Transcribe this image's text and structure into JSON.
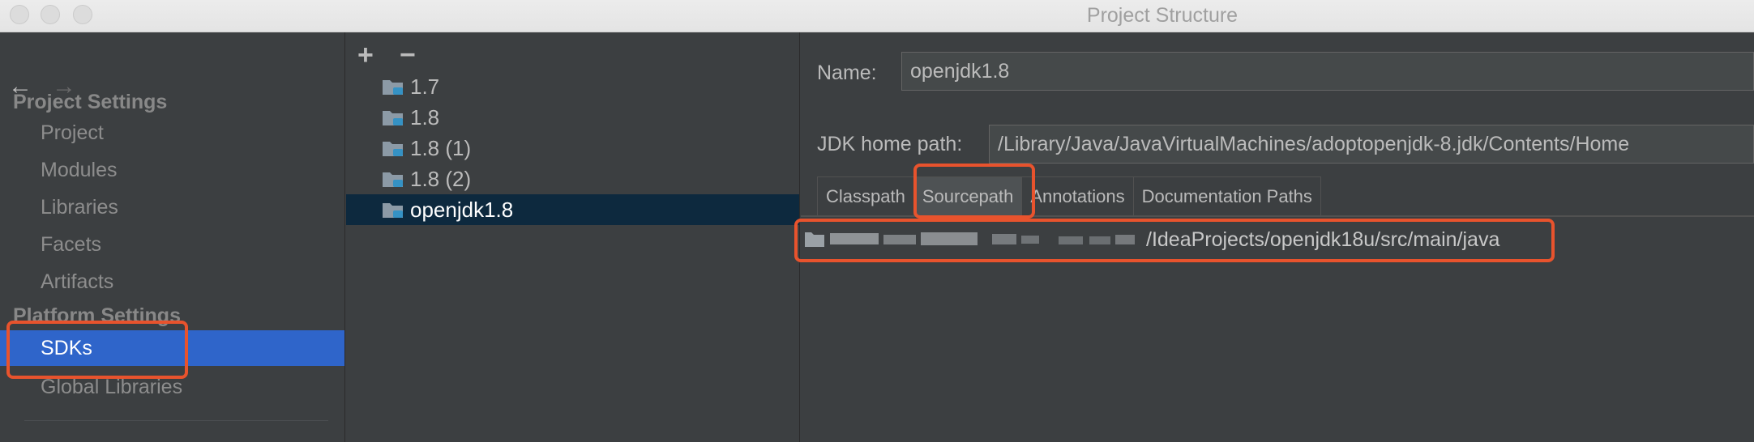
{
  "window": {
    "title": "Project Structure"
  },
  "nav": {
    "back_icon": "arrow-left-icon",
    "forward_icon": "arrow-right-icon"
  },
  "left_pane": {
    "project_settings_header": "Project Settings",
    "project_items": [
      {
        "label": "Project"
      },
      {
        "label": "Modules"
      },
      {
        "label": "Libraries"
      },
      {
        "label": "Facets"
      },
      {
        "label": "Artifacts"
      }
    ],
    "platform_settings_header": "Platform Settings",
    "platform_items": [
      {
        "label": "SDKs",
        "selected": true
      },
      {
        "label": "Global Libraries"
      }
    ]
  },
  "sdk_list": {
    "add_label": "+",
    "remove_label": "−",
    "items": [
      {
        "label": "1.7"
      },
      {
        "label": "1.8"
      },
      {
        "label": "1.8 (1)"
      },
      {
        "label": "1.8 (2)"
      },
      {
        "label": "openjdk1.8",
        "selected": true
      }
    ]
  },
  "details": {
    "name_label": "Name:",
    "name_value": "openjdk1.8",
    "home_label": "JDK home path:",
    "home_value": "/Library/Java/JavaVirtualMachines/adoptopenjdk-8.jdk/Contents/Home",
    "tabs": [
      {
        "label": "Classpath"
      },
      {
        "label": "Sourcepath",
        "active": true
      },
      {
        "label": "Annotations"
      },
      {
        "label": "Documentation Paths"
      }
    ],
    "source_path_suffix": "/IdeaProjects/openjdk18u/src/main/java"
  },
  "colors": {
    "background": "#3c3f41",
    "selection_blue": "#2f65ca",
    "list_selection": "#0d293e",
    "highlight": "#e8532d"
  }
}
